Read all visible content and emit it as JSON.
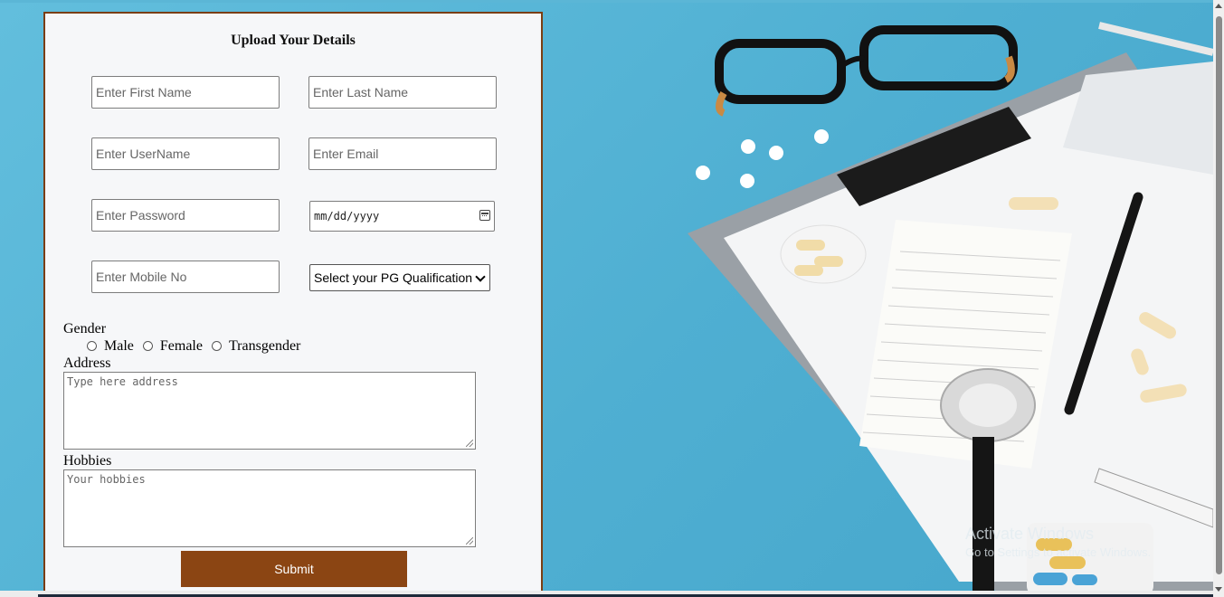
{
  "form": {
    "title": "Upload Your Details",
    "first_name_placeholder": "Enter First Name",
    "last_name_placeholder": "Enter Last Name",
    "username_placeholder": "Enter UserName",
    "email_placeholder": "Enter Email",
    "password_placeholder": "Enter Password",
    "date_placeholder": "mm/dd/yyyy",
    "mobile_placeholder": "Enter Mobile No",
    "qualification_selected": "Select your PG Qualification",
    "gender_label": "Gender",
    "gender_options": [
      "Male",
      "Female",
      "Transgender"
    ],
    "address_label": "Address",
    "address_placeholder": "Type here address",
    "hobbies_label": "Hobbies",
    "hobbies_placeholder": "Your hobbies",
    "submit_label": "Submit"
  },
  "watermark": {
    "line1": "Activate Windows",
    "line2": "Go to Settings to activate Windows."
  },
  "colors": {
    "accent": "#8b4513",
    "background": "#5bb6d6",
    "card": "#f6f7f9"
  }
}
